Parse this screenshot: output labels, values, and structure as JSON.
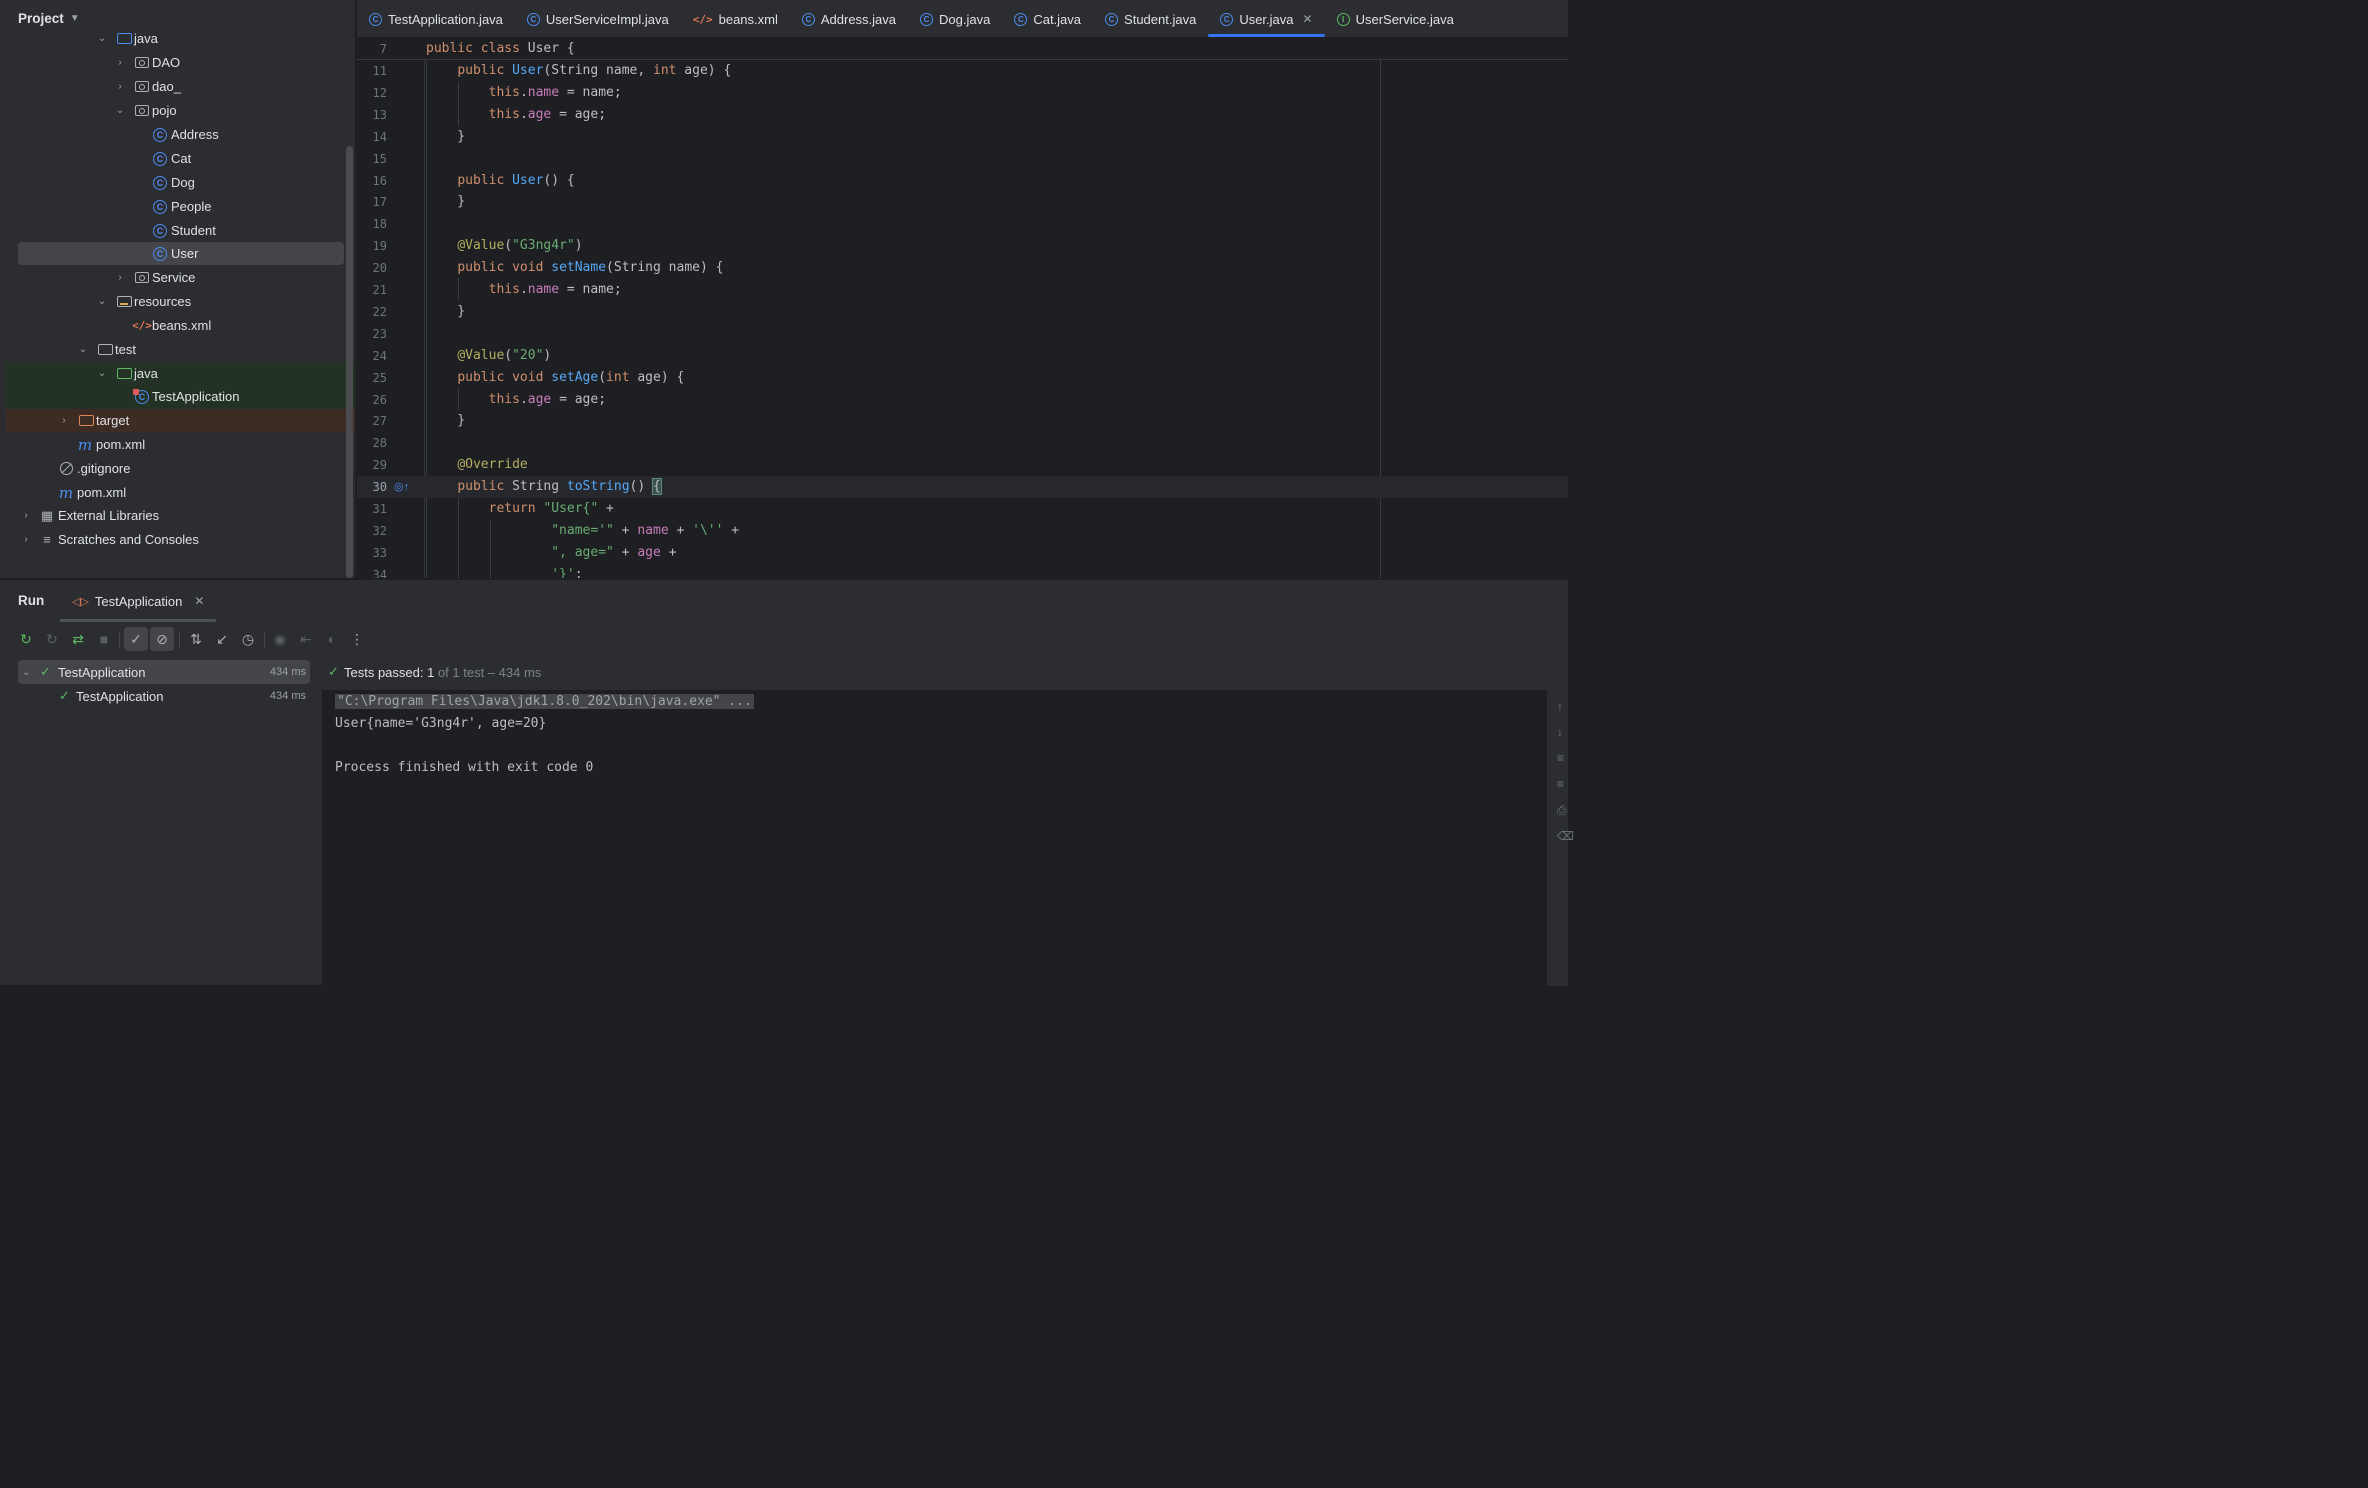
{
  "project": {
    "title": "Project",
    "tree": [
      {
        "label": "java",
        "type": "folder-blue"
      },
      {
        "label": "DAO",
        "type": "package"
      },
      {
        "label": "dao_",
        "type": "package"
      },
      {
        "label": "pojo",
        "type": "package"
      },
      {
        "label": "Address",
        "type": "class"
      },
      {
        "label": "Cat",
        "type": "class"
      },
      {
        "label": "Dog",
        "type": "class"
      },
      {
        "label": "People",
        "type": "class"
      },
      {
        "label": "Student",
        "type": "class"
      },
      {
        "label": "User",
        "type": "class"
      },
      {
        "label": "Service",
        "type": "package"
      },
      {
        "label": "resources",
        "type": "resources-folder"
      },
      {
        "label": "beans.xml",
        "type": "xml"
      },
      {
        "label": "test",
        "type": "folder"
      },
      {
        "label": "java",
        "type": "folder-green"
      },
      {
        "label": "TestApplication",
        "type": "test-class"
      },
      {
        "label": "target",
        "type": "folder-orange"
      },
      {
        "label": "pom.xml",
        "type": "maven"
      },
      {
        "label": ".gitignore",
        "type": "ignore"
      },
      {
        "label": "pom.xml",
        "type": "maven"
      },
      {
        "label": "External Libraries",
        "type": "libraries"
      },
      {
        "label": "Scratches and Consoles",
        "type": "scratches"
      }
    ]
  },
  "tabs": [
    {
      "label": "TestApplication.java",
      "icon": "class-icon"
    },
    {
      "label": "UserServiceImpl.java",
      "icon": "class-icon"
    },
    {
      "label": "beans.xml",
      "icon": "xml-file-icon"
    },
    {
      "label": "Address.java",
      "icon": "class-icon"
    },
    {
      "label": "Dog.java",
      "icon": "class-icon"
    },
    {
      "label": "Cat.java",
      "icon": "class-icon"
    },
    {
      "label": "Student.java",
      "icon": "class-icon"
    },
    {
      "label": "User.java",
      "icon": "class-icon",
      "active": true
    },
    {
      "label": "UserService.java",
      "icon": "interface-icon"
    }
  ],
  "editor": {
    "sticky_line_number": "7",
    "sticky_line": "public class User {",
    "current_line": "30",
    "lines": [
      {
        "n": "11",
        "text": "    public User(String name, int age) {"
      },
      {
        "n": "12",
        "text": "        this.name = name;"
      },
      {
        "n": "13",
        "text": "        this.age = age;"
      },
      {
        "n": "14",
        "text": "    }"
      },
      {
        "n": "15",
        "text": ""
      },
      {
        "n": "16",
        "text": "    public User() {"
      },
      {
        "n": "17",
        "text": "    }"
      },
      {
        "n": "18",
        "text": ""
      },
      {
        "n": "19",
        "text": "    @Value(\"G3ng4r\")"
      },
      {
        "n": "20",
        "text": "    public void setName(String name) {"
      },
      {
        "n": "21",
        "text": "        this.name = name;"
      },
      {
        "n": "22",
        "text": "    }"
      },
      {
        "n": "23",
        "text": ""
      },
      {
        "n": "24",
        "text": "    @Value(\"20\")"
      },
      {
        "n": "25",
        "text": "    public void setAge(int age) {"
      },
      {
        "n": "26",
        "text": "        this.age = age;"
      },
      {
        "n": "27",
        "text": "    }"
      },
      {
        "n": "28",
        "text": ""
      },
      {
        "n": "29",
        "text": "    @Override"
      },
      {
        "n": "30",
        "text": "    public String toString() {"
      },
      {
        "n": "31",
        "text": "        return \"User{\" +"
      },
      {
        "n": "32",
        "text": "                \"name='\" + name + '\\'' +"
      },
      {
        "n": "33",
        "text": "                \", age=\" + age +"
      },
      {
        "n": "34",
        "text": "                '}';"
      }
    ]
  },
  "run": {
    "title": "Run",
    "tab_label": "TestApplication",
    "status_passed": "Tests passed: 1",
    "status_detail": " of 1 test – 434 ms",
    "tree": [
      {
        "label": "TestApplication",
        "time": "434 ms",
        "expanded": true
      },
      {
        "label": "TestApplication",
        "time": "434 ms"
      }
    ],
    "console": [
      "\"C:\\Program Files\\Java\\jdk1.8.0_202\\bin\\java.exe\" ...",
      "User{name='G3ng4r', age=20}",
      "",
      "Process finished with exit code 0"
    ]
  },
  "colors": {
    "background": "#1e1f22",
    "panel": "#2b2d30",
    "accent": "#3574f0",
    "keyword": "#cf8e6d",
    "function": "#56a8f5",
    "field": "#c77dbb",
    "string": "#6aab73",
    "annotation": "#b3ae60",
    "success": "#5fb865"
  }
}
